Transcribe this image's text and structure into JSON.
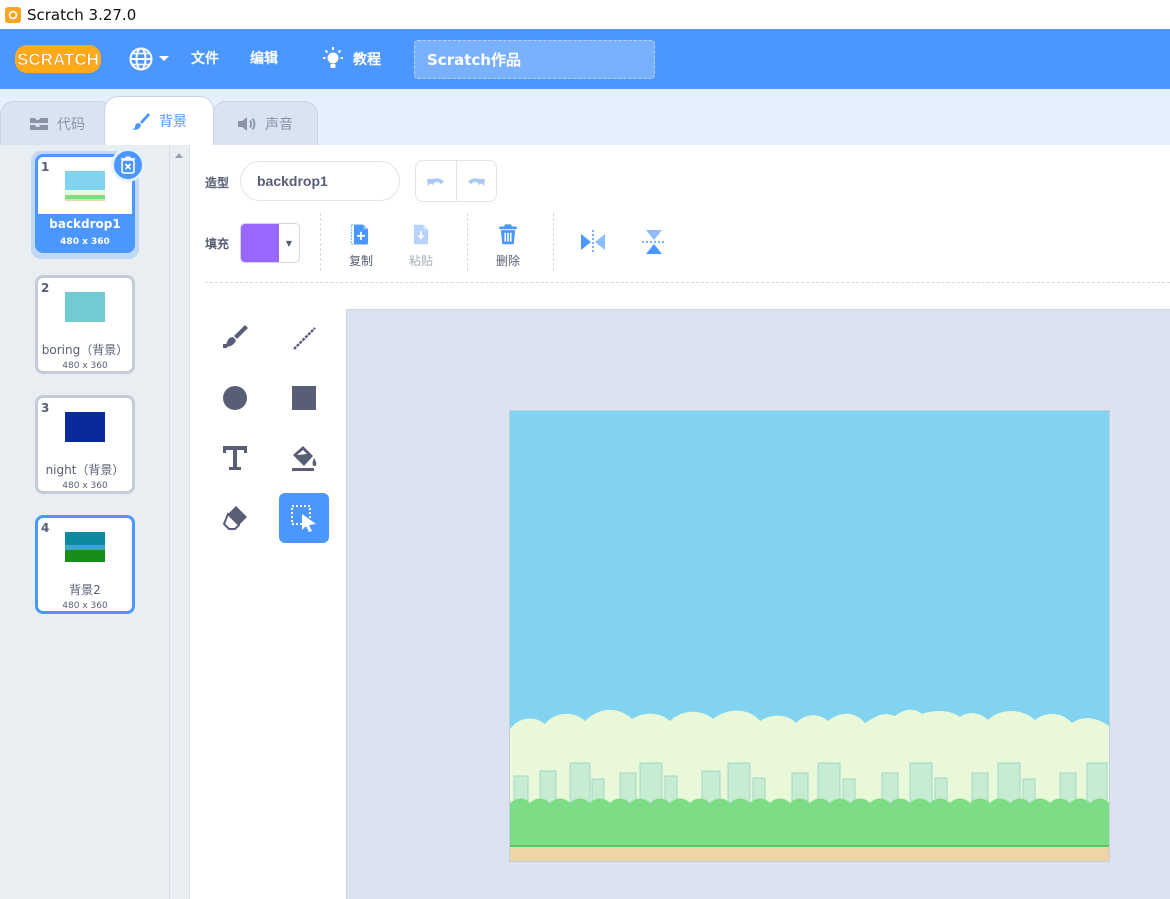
{
  "window": {
    "title": "Scratch 3.27.0"
  },
  "menubar": {
    "logo_text": "SCRATCH",
    "menu_file": "文件",
    "menu_edit": "编辑",
    "tutorials": "教程",
    "project_title": "Scratch作品"
  },
  "tabs": [
    {
      "label": "代码",
      "icon": "code-blocks-icon"
    },
    {
      "label": "背景",
      "icon": "paintbrush-icon",
      "active": true
    },
    {
      "label": "声音",
      "icon": "speaker-icon"
    }
  ],
  "backdrops": [
    {
      "num": "1",
      "name": "backdrop1",
      "size": "480 x 360",
      "selected": true
    },
    {
      "num": "2",
      "name": "boring（背景）",
      "size": "480 x 360"
    },
    {
      "num": "3",
      "name": "night（背景）",
      "size": "480 x 360"
    },
    {
      "num": "4",
      "name": "背景2",
      "size": "480 x 360"
    }
  ],
  "editor": {
    "costume_label": "造型",
    "costume_name": "backdrop1",
    "fill_label": "填充",
    "fill_color": "#9966ff",
    "copy": "复制",
    "paste": "粘贴",
    "delete": "删除"
  },
  "colors": {
    "menubar": "#4c97ff",
    "accent": "#4c97ff",
    "sky": "#81d3f0",
    "grass": "#7ddc86",
    "ground": "#f1d4a5"
  },
  "tools": [
    "brush-icon",
    "line-icon",
    "circle-icon",
    "rectangle-icon",
    "text-icon",
    "fill-bucket-icon",
    "eraser-icon",
    "select-icon"
  ]
}
